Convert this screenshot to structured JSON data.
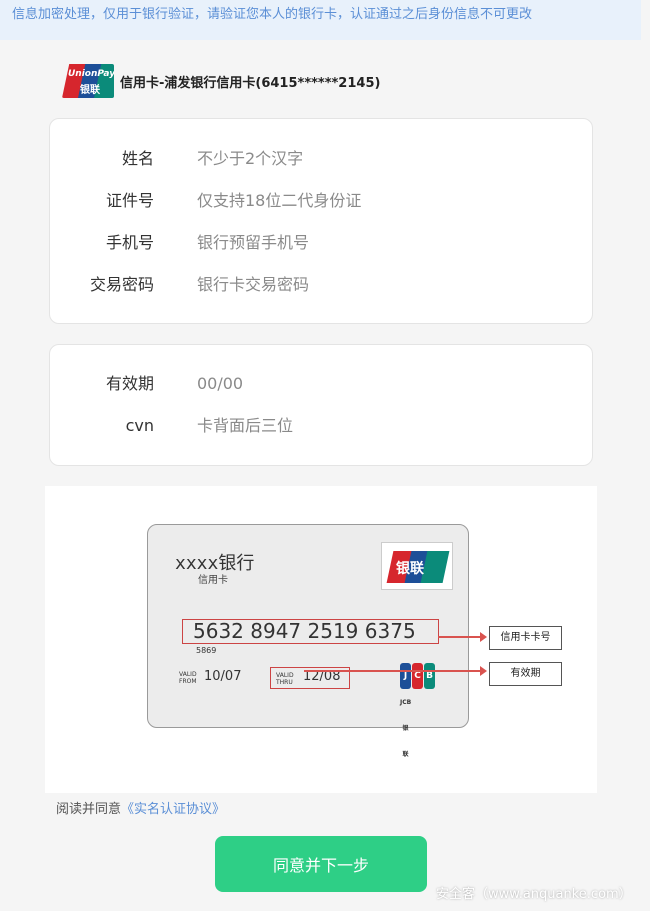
{
  "notice": "信息加密处理，仅用于银行验证，请验证您本人的银行卡，认证通过之后身份信息不可更改",
  "card": {
    "logo_text_en": "UnionPay",
    "logo_text_cn": "银联",
    "title": "信用卡-浦发银行信用卡(6415******2145)"
  },
  "form1": [
    {
      "label": "姓名",
      "placeholder": "不少于2个汉字"
    },
    {
      "label": "证件号",
      "placeholder": "仅支持18位二代身份证"
    },
    {
      "label": "手机号",
      "placeholder": "银行预留手机号"
    },
    {
      "label": "交易密码",
      "placeholder": "银行卡交易密码"
    }
  ],
  "form2": [
    {
      "label": "有效期",
      "placeholder": "00/00"
    },
    {
      "label": "cvn",
      "placeholder": "卡背面后三位"
    }
  ],
  "illustration": {
    "bank_name": "xxxx银行",
    "bank_sub": "信用卡",
    "unionpay": "银联",
    "card_number": "5632 8947 2519 6375",
    "card_number_sub": "5869",
    "valid_from_label": "VALID FROM",
    "valid_from": "10/07",
    "valid_thru_label": "VALID THRU",
    "valid_thru": "12/08",
    "jcb": "JCB",
    "jcb_sub": "JCB 银联",
    "tag_number": "信用卡卡号",
    "tag_expiry": "有效期"
  },
  "agree": {
    "prefix": "阅读并同意",
    "link": "《实名认证协议》"
  },
  "next_button": "同意并下一步",
  "watermark": "安全客（www.anquanke.com）",
  "colors": {
    "accent_green": "#2ecf86",
    "link_blue": "#5b8fd6",
    "notice_bg": "#e8f1fb"
  }
}
